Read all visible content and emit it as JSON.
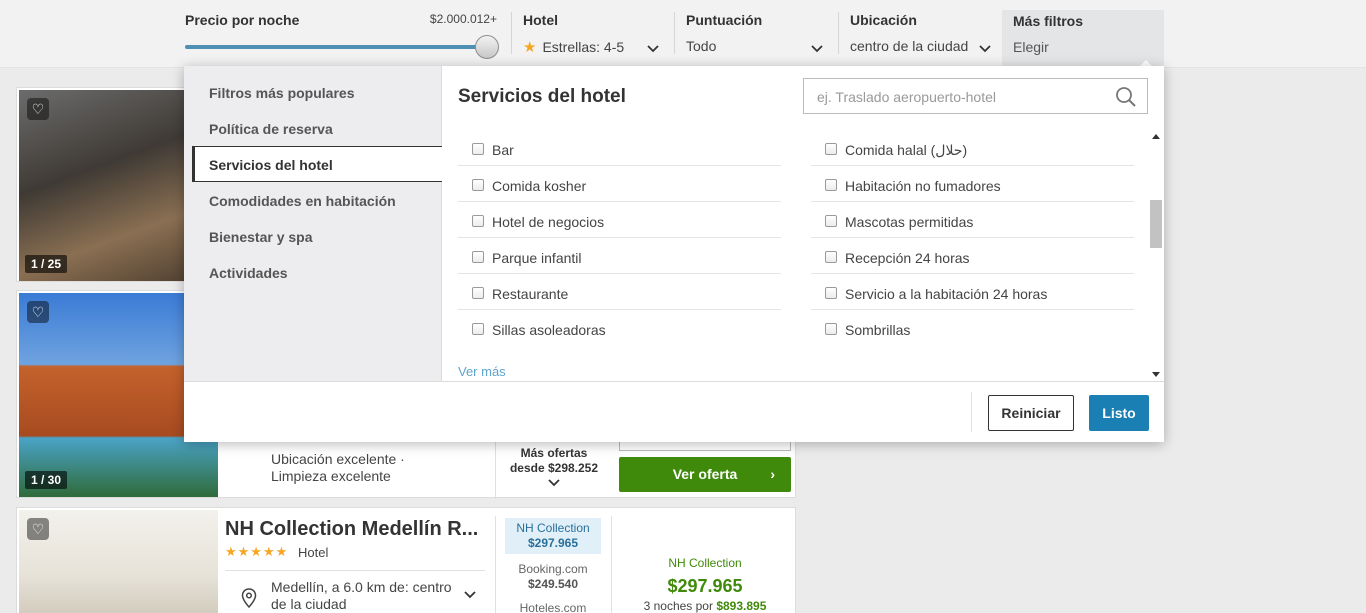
{
  "filters": {
    "price": {
      "title": "Precio por noche",
      "max_label": "$2.000.012+",
      "level": 1.0
    },
    "hotel": {
      "title": "Hotel",
      "value": "Estrellas: 4-5"
    },
    "rating": {
      "title": "Puntuación",
      "value": "Todo"
    },
    "location": {
      "title": "Ubicación",
      "value": "centro de la ciudad"
    },
    "more": {
      "title": "Más filtros",
      "value": "Elegir"
    }
  },
  "panel": {
    "categories": [
      "Filtros más populares",
      "Política de reserva",
      "Servicios del hotel",
      "Comodidades en habitación",
      "Bienestar y spa",
      "Actividades"
    ],
    "active_category": "Servicios del hotel",
    "section_title": "Servicios del hotel",
    "search_placeholder": "ej. Traslado aeropuerto-hotel",
    "options_left": [
      "Bar",
      "Comida kosher",
      "Hotel de negocios",
      "Parque infantil",
      "Restaurante",
      "Sillas asoleadoras"
    ],
    "options_right": [
      "Comida halal (حلال)",
      "Habitación no fumadores",
      "Mascotas permitidas",
      "Recepción 24 horas",
      "Servicio a la habitación 24 horas",
      "Sombrillas"
    ],
    "see_more": "Ver más",
    "reset_label": "Reiniciar",
    "done_label": "Listo"
  },
  "cards": {
    "card1": {
      "counter": "1 / 25"
    },
    "card2": {
      "counter": "1 / 30",
      "highlight1": "Ubicación excelente ·",
      "highlight2": "Limpieza excelente",
      "more_offers": "Más ofertas",
      "from_price": "desde $298.252",
      "cta": "Ver oferta"
    },
    "card3": {
      "name": "NH Collection Medellín R...",
      "stars": "★★★★★",
      "type": "Hotel",
      "location_line1": "Medellín, a 6.0 km de: centro",
      "location_line2": "de la ciudad",
      "providers": [
        {
          "name": "NH Collection",
          "price": "$297.965"
        },
        {
          "name": "Booking.com",
          "price": "$249.540"
        },
        {
          "name": "Hoteles.com",
          "price": ""
        }
      ],
      "best_provider": "NH Collection",
      "best_price": "$297.965",
      "nights_text": "3 noches por",
      "nights_price": "$893.895"
    }
  },
  "colors": {
    "accent_blue": "#1a7fb3",
    "cta_green": "#3f8a0a",
    "star_yellow": "#f5a623"
  }
}
